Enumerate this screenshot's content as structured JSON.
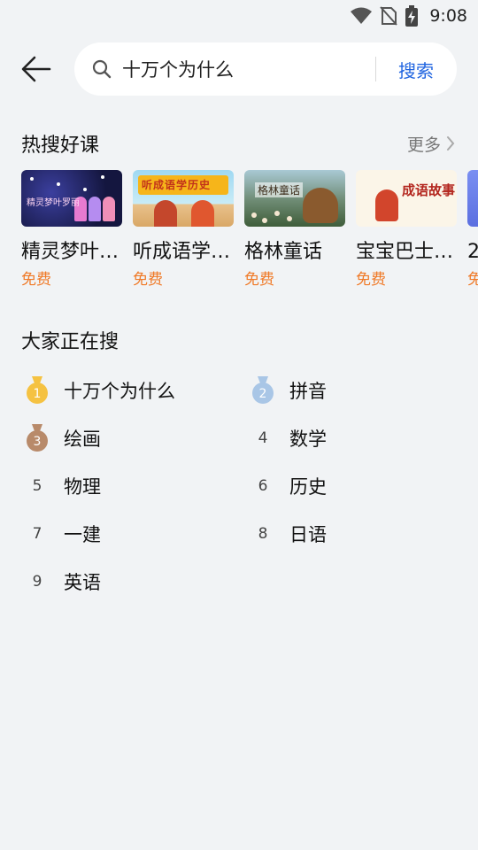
{
  "status_bar": {
    "time": "9:08",
    "icons": [
      "wifi-icon",
      "no-sim-icon",
      "battery-charging-icon"
    ]
  },
  "search": {
    "value": "十万个为什么",
    "submit_label": "搜索"
  },
  "hot_courses": {
    "title": "热搜好课",
    "more_label": "更多",
    "items": [
      {
        "title": "精灵梦叶…",
        "price": "免费",
        "thumb_text": "精灵梦叶罗丽"
      },
      {
        "title": "听成语学…",
        "price": "免费",
        "thumb_text": "听成语学历史"
      },
      {
        "title": "格林童话",
        "price": "免费",
        "thumb_text": "格林童话"
      },
      {
        "title": "宝宝巴士…",
        "price": "免费",
        "thumb_text": "成语故事"
      },
      {
        "title": "2",
        "price": "免",
        "thumb_text": ""
      }
    ]
  },
  "trending": {
    "title": "大家正在搜",
    "items": [
      {
        "rank": "1",
        "label": "十万个为什么",
        "badge": "gold"
      },
      {
        "rank": "2",
        "label": "拼音",
        "badge": "silver"
      },
      {
        "rank": "3",
        "label": "绘画",
        "badge": "bronze"
      },
      {
        "rank": "4",
        "label": "数学"
      },
      {
        "rank": "5",
        "label": "物理"
      },
      {
        "rank": "6",
        "label": "历史"
      },
      {
        "rank": "7",
        "label": "一建"
      },
      {
        "rank": "8",
        "label": "日语"
      },
      {
        "rank": "9",
        "label": "英语"
      }
    ]
  },
  "colors": {
    "accent": "#2165e0",
    "price": "#f07a28",
    "gold": "#f5c242",
    "silver": "#a9c6e6",
    "bronze": "#b88a6a"
  }
}
